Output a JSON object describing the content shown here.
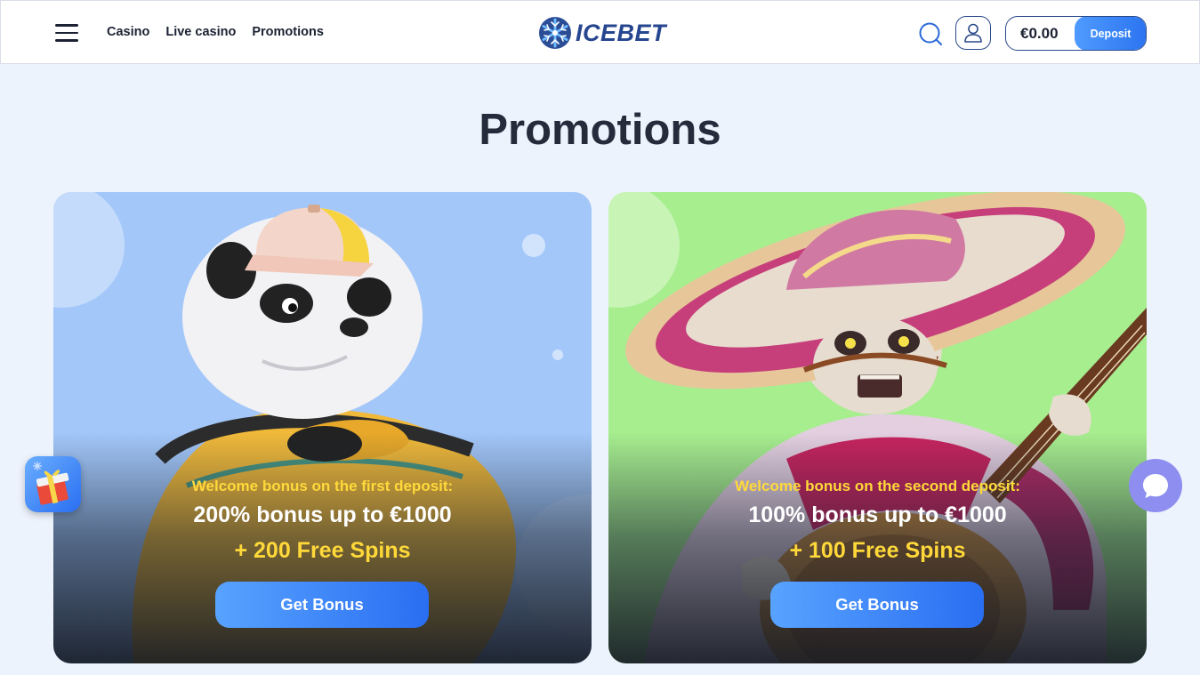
{
  "header": {
    "nav": [
      "Casino",
      "Live casino",
      "Promotions"
    ],
    "logo_text": "ICEBET",
    "balance": "€0.00",
    "deposit_label": "Deposit"
  },
  "page": {
    "title": "Promotions"
  },
  "promotions": [
    {
      "subtitle": "Welcome bonus on the first deposit:",
      "headline": "200% bonus up to €1000",
      "spins": "+ 200 Free Spins",
      "button": "Get Bonus",
      "background": "#a3c7f9",
      "art": "panda-icon"
    },
    {
      "subtitle": "Welcome bonus on the second deposit:",
      "headline": "100% bonus up to €1000",
      "spins": "+ 100 Free Spins",
      "button": "Get Bonus",
      "background": "#a7ee8f",
      "art": "mariachi-skeleton-icon"
    }
  ],
  "icons": {
    "menu": "hamburger-menu-icon",
    "logo": "snowflake-icon",
    "search": "search-icon",
    "user": "user-icon",
    "gift": "gift-icon",
    "chat": "chat-icon"
  },
  "colors": {
    "accent": "#2b74f0",
    "highlight": "#ffd93a",
    "brand": "#264690"
  }
}
